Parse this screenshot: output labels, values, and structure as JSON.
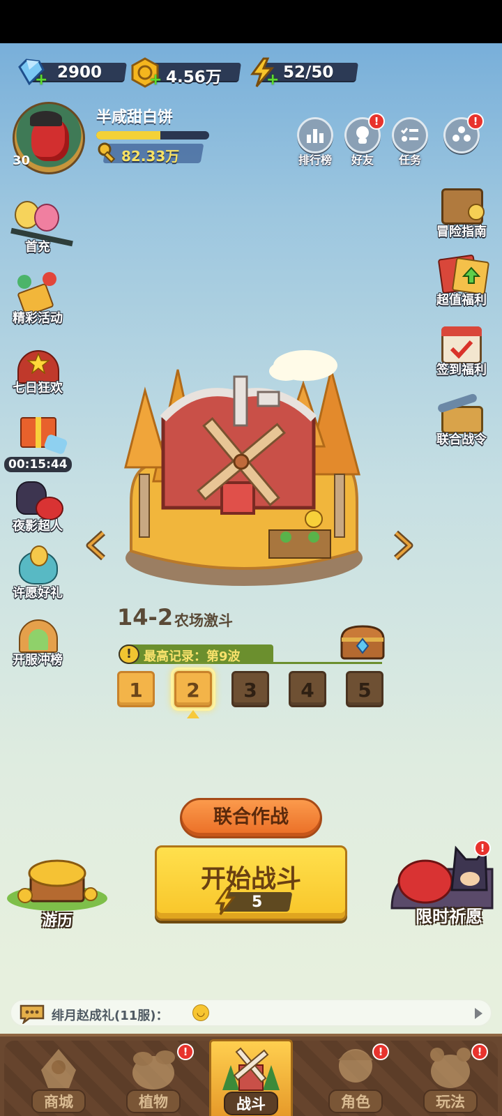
{
  "currency": {
    "gems": "2900",
    "coins": "4.56万",
    "energy": "52/50"
  },
  "profile": {
    "name": "半咸甜白饼",
    "level": "30",
    "xp_fraction": 0.57,
    "keys": "82.33万"
  },
  "top_menu": [
    {
      "label": "排行榜",
      "icon": "leaderboard-icon",
      "alert": false
    },
    {
      "label": "好友",
      "icon": "friends-icon",
      "alert": true
    },
    {
      "label": "任务",
      "icon": "tasks-icon",
      "alert": false
    },
    {
      "label": "",
      "icon": "more-menu-icon",
      "alert": true
    }
  ],
  "left_menu": {
    "first_charge": "首充",
    "events": "精彩活动",
    "seven_day": "七日狂欢",
    "timer": "00:15:44",
    "night_hero": "夜影超人",
    "wish_gift": "许愿好礼",
    "server_rank": "开服冲榜"
  },
  "right_menu": {
    "guide": "冒险指南",
    "value_welfare": "超值福利",
    "signin": "签到福利",
    "battle_pass": "联合战令"
  },
  "stage": {
    "id": "14-2",
    "name": "农场激斗",
    "record_info_icon": "!",
    "record": "最高记录：第9波",
    "waves": [
      {
        "label": "1",
        "state": "open"
      },
      {
        "label": "2",
        "state": "selected"
      },
      {
        "label": "3",
        "state": "locked"
      },
      {
        "label": "4",
        "state": "locked"
      },
      {
        "label": "5",
        "state": "locked"
      }
    ]
  },
  "actions": {
    "coop": "联合作战",
    "start": "开始战斗",
    "start_cost": "5",
    "travel": "游历",
    "limited_wish": "限时祈愿",
    "alert_mark": "!"
  },
  "chat": {
    "text": "绯月赵成礼(11服)："
  },
  "tabs": [
    {
      "label": "商城",
      "alert": false
    },
    {
      "label": "植物",
      "alert": true
    },
    {
      "label": "战斗",
      "alert": false,
      "active": true
    },
    {
      "label": "角色",
      "alert": true
    },
    {
      "label": "玩法",
      "alert": true
    }
  ],
  "colors": {
    "accent_yellow": "#f8c529",
    "alert_red": "#e8332d",
    "record_green": "#6b8f2e"
  }
}
